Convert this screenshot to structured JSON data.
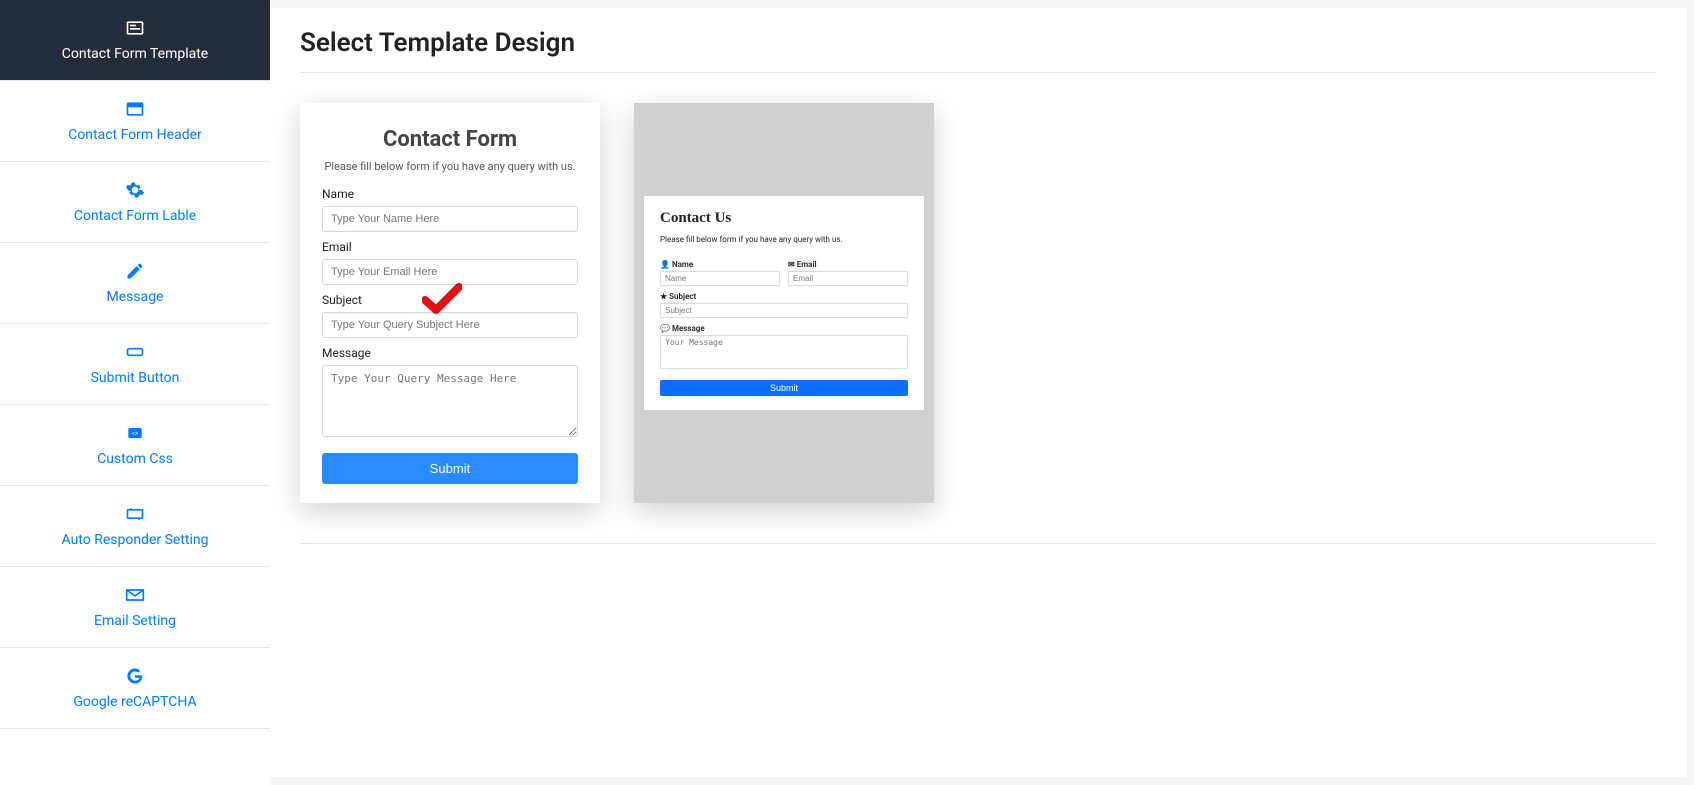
{
  "sidebar": {
    "items": [
      {
        "label": "Contact Form Template",
        "icon": "form-icon",
        "active": true
      },
      {
        "label": "Contact Form Header",
        "icon": "header-icon",
        "active": false
      },
      {
        "label": "Contact Form Lable",
        "icon": "gear-icon",
        "active": false
      },
      {
        "label": "Message",
        "icon": "edit-icon",
        "active": false
      },
      {
        "label": "Submit Button",
        "icon": "button-icon",
        "active": false
      },
      {
        "label": "Custom Css",
        "icon": "code-icon",
        "active": false
      },
      {
        "label": "Auto Responder Setting",
        "icon": "responder-icon",
        "active": false
      },
      {
        "label": "Email Setting",
        "icon": "mail-icon",
        "active": false
      },
      {
        "label": "Google reCAPTCHA",
        "icon": "google-icon",
        "active": false
      }
    ]
  },
  "page": {
    "title": "Select Template Design"
  },
  "template1": {
    "title": "Contact Form",
    "subtitle": "Please fill below form if you have any query with us.",
    "name_label": "Name",
    "name_placeholder": "Type Your Name Here",
    "email_label": "Email",
    "email_placeholder": "Type Your Email Here",
    "subject_label": "Subject",
    "subject_placeholder": "Type Your Query Subject Here",
    "message_label": "Message",
    "message_placeholder": "Type Your Query Message Here",
    "submit_label": "Submit",
    "selected": true
  },
  "template2": {
    "title": "Contact Us",
    "subtitle": "Please fill below form if you have any query with us.",
    "name_label": "Name",
    "name_placeholder": "Name",
    "email_label": "Email",
    "email_placeholder": "Email",
    "subject_label": "Subject",
    "subject_placeholder": "Subject",
    "message_label": "Message",
    "message_placeholder": "Your Message",
    "submit_label": "Submit",
    "selected": false
  }
}
